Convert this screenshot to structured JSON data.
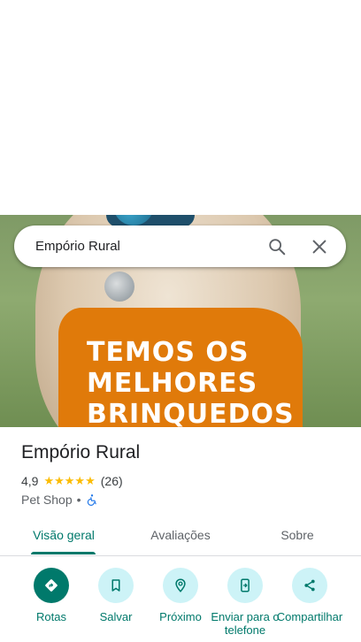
{
  "search": {
    "query": "Empório Rural"
  },
  "hero": {
    "promo_lines": [
      "TEMOS OS",
      "MELHORES",
      "BRINQUEDOS"
    ]
  },
  "place": {
    "name": "Empório Rural",
    "rating": "4,9",
    "stars": "★★★★★",
    "reviews": "(26)",
    "category": "Pet Shop",
    "separator": "•"
  },
  "tabs": [
    {
      "label": "Visão geral",
      "active": true
    },
    {
      "label": "Avaliações",
      "active": false
    },
    {
      "label": "Sobre",
      "active": false
    }
  ],
  "actions": [
    {
      "label": "Rotas",
      "icon": "directions-icon"
    },
    {
      "label": "Salvar",
      "icon": "bookmark-icon"
    },
    {
      "label": "Próximo",
      "icon": "nearby-icon"
    },
    {
      "label": "Enviar para o telefone",
      "icon": "send-to-phone-icon"
    },
    {
      "label": "Compartilhar",
      "icon": "share-icon"
    }
  ],
  "colors": {
    "accent": "#00796b",
    "action_bg": "#cdf3f7",
    "promo_orange": "#e07a0a",
    "star": "#fbbc04"
  }
}
